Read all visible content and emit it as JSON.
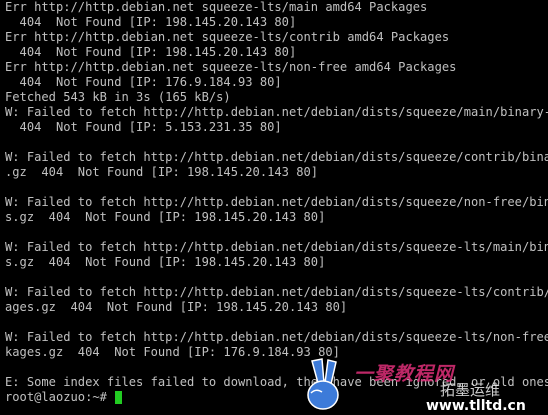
{
  "terminal": {
    "lines": [
      "Err http://http.debian.net squeeze-lts/main amd64 Packages",
      "  404  Not Found [IP: 198.145.20.143 80]",
      "Err http://http.debian.net squeeze-lts/contrib amd64 Packages",
      "  404  Not Found [IP: 198.145.20.143 80]",
      "Err http://http.debian.net squeeze-lts/non-free amd64 Packages",
      "  404  Not Found [IP: 176.9.184.93 80]",
      "Fetched 543 kB in 3s (165 kB/s)",
      "W: Failed to fetch http://http.debian.net/debian/dists/squeeze/main/binary-amd",
      "  404  Not Found [IP: 5.153.231.35 80]",
      "",
      "W: Failed to fetch http://http.debian.net/debian/dists/squeeze/contrib/binary-",
      ".gz  404  Not Found [IP: 198.145.20.143 80]",
      "",
      "W: Failed to fetch http://http.debian.net/debian/dists/squeeze/non-free/binary",
      "s.gz  404  Not Found [IP: 198.145.20.143 80]",
      "",
      "W: Failed to fetch http://http.debian.net/debian/dists/squeeze-lts/main/binary",
      "s.gz  404  Not Found [IP: 198.145.20.143 80]",
      "",
      "W: Failed to fetch http://http.debian.net/debian/dists/squeeze-lts/contrib/bin",
      "ages.gz  404  Not Found [IP: 198.145.20.143 80]",
      "",
      "W: Failed to fetch http://http.debian.net/debian/dists/squeeze-lts/non-free/bi",
      "kages.gz  404  Not Found [IP: 176.9.184.93 80]",
      "",
      "E: Some index files failed to download, they have been ignored, or old ones us"
    ],
    "prompt": "root@laozuo:~# ",
    "colors": {
      "background": "#000000",
      "text": "#c0c0c0",
      "cursor": "#22cc22"
    }
  },
  "watermark": {
    "site_name": "一聚教程网",
    "tagline": "拓墨运维",
    "url": "www.tlltd.cn",
    "logo_icon": "victory-hand-icon"
  }
}
